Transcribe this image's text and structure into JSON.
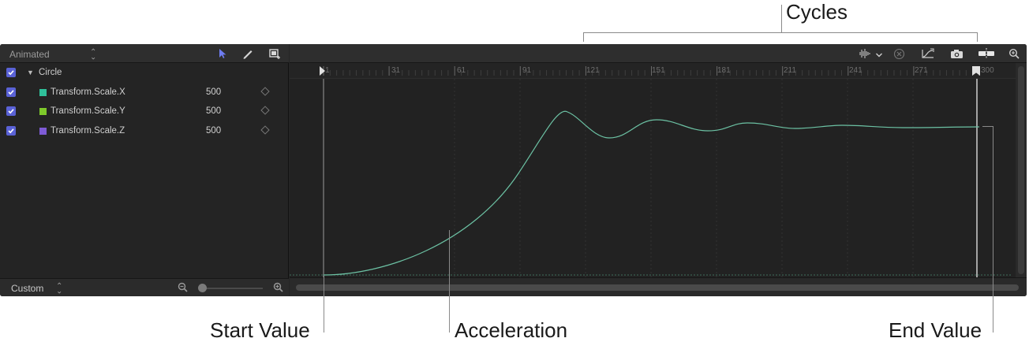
{
  "callouts": {
    "cycles": "Cycles",
    "start_value": "Start Value",
    "acceleration": "Acceleration",
    "end_value": "End Value"
  },
  "left_panel": {
    "filter_dropdown": "Animated",
    "object_name": "Circle",
    "parameters": [
      {
        "name": "Transform.Scale.X",
        "value": "500",
        "color": "#2fc09a",
        "checked": true
      },
      {
        "name": "Transform.Scale.Y",
        "value": "500",
        "color": "#7ec92b",
        "checked": true
      },
      {
        "name": "Transform.Scale.Z",
        "value": "500",
        "color": "#7e5bd6",
        "checked": true
      }
    ],
    "zoom_preset": "Custom"
  },
  "timeline": {
    "ruler_labels": [
      "1",
      "31",
      "61",
      "91",
      "121",
      "151",
      "181",
      "211",
      "241",
      "271",
      "300"
    ]
  },
  "colors": {
    "curve": "#6cc2a4",
    "accent": "#5a62d6",
    "panel": "#262626"
  },
  "icons": {
    "arrow_tool": "arrow-pointer-icon",
    "pen_tool": "pen-icon",
    "transform_tool": "transform-box-icon",
    "audio": "waveform-icon",
    "clear": "clear-x-icon",
    "fit": "fit-curve-icon",
    "snapshot": "camera-icon",
    "snap": "snap-icon",
    "zoom": "zoom-in-icon"
  }
}
